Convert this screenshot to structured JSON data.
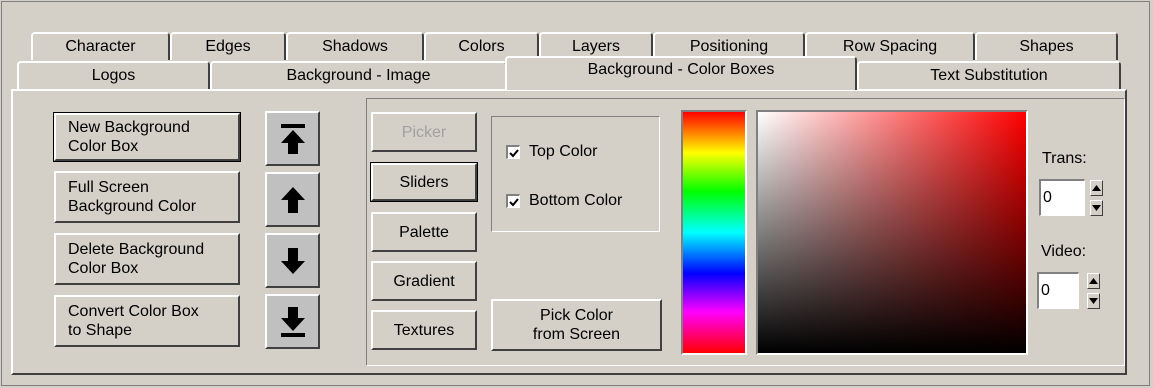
{
  "tabs_row_back": [
    {
      "label": "Character"
    },
    {
      "label": "Edges"
    },
    {
      "label": "Shadows"
    },
    {
      "label": "Colors"
    },
    {
      "label": "Layers"
    },
    {
      "label": "Positioning"
    },
    {
      "label": "Row Spacing"
    },
    {
      "label": "Shapes"
    }
  ],
  "tabs_row_front": [
    {
      "label": "Logos"
    },
    {
      "label": "Background - Image"
    },
    {
      "label": "Background - Color Boxes",
      "active": true
    },
    {
      "label": "Text Substitution"
    }
  ],
  "actions": {
    "new_box": "New Background\nColor Box",
    "full_screen": "Full Screen\nBackground Color",
    "delete_box": "Delete Background\nColor Box",
    "convert_box": "Convert Color Box\nto Shape"
  },
  "order_buttons": {
    "icons": [
      "move-to-top-icon",
      "move-up-icon",
      "move-down-icon",
      "move-to-bottom-icon"
    ]
  },
  "color_modes": {
    "picker": "Picker",
    "sliders": "Sliders",
    "palette": "Palette",
    "gradient": "Gradient",
    "textures": "Textures"
  },
  "color_targets": {
    "top_color": "Top Color",
    "top_checked": true,
    "bottom_color": "Bottom Color",
    "bottom_checked": true
  },
  "pick_from_screen": "Pick Color\nfrom Screen",
  "trans": {
    "label": "Trans:",
    "value": "0"
  },
  "video": {
    "label": "Video:",
    "value": "0"
  },
  "colors": {
    "selected_hue": "#ff0000"
  }
}
